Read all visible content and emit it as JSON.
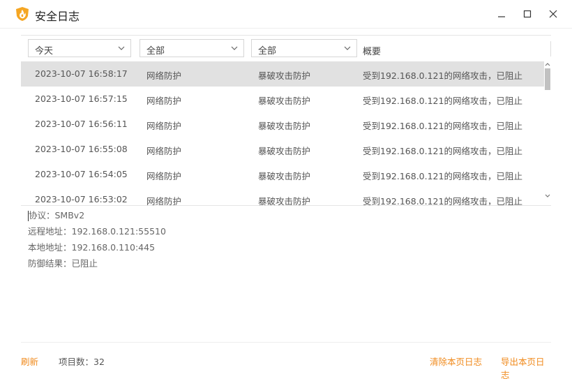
{
  "window": {
    "title": "安全日志",
    "icon": "shield-flame-logo-icon"
  },
  "filters": {
    "time": "今天",
    "category": "全部",
    "type": "全部",
    "summary_header": "概要"
  },
  "rows": [
    {
      "time": "2023-10-07 16:58:17",
      "category": "网络防护",
      "type": "暴破攻击防护",
      "summary": "受到192.168.0.121的网络攻击，已阻止"
    },
    {
      "time": "2023-10-07 16:57:15",
      "category": "网络防护",
      "type": "暴破攻击防护",
      "summary": "受到192.168.0.121的网络攻击，已阻止"
    },
    {
      "time": "2023-10-07 16:56:11",
      "category": "网络防护",
      "type": "暴破攻击防护",
      "summary": "受到192.168.0.121的网络攻击，已阻止"
    },
    {
      "time": "2023-10-07 16:55:08",
      "category": "网络防护",
      "type": "暴破攻击防护",
      "summary": "受到192.168.0.121的网络攻击，已阻止"
    },
    {
      "time": "2023-10-07 16:54:05",
      "category": "网络防护",
      "type": "暴破攻击防护",
      "summary": "受到192.168.0.121的网络攻击，已阻止"
    },
    {
      "time": "2023-10-07 16:53:02",
      "category": "网络防护",
      "type": "暴破攻击防护",
      "summary": "受到192.168.0.121的网络攻击，已阻止"
    }
  ],
  "details": {
    "protocol": "协议：SMBv2",
    "remote": "远程地址：192.168.0.121:55510",
    "local": "本地地址：192.168.0.110:445",
    "result": "防御结果：已阻止"
  },
  "footer": {
    "refresh": "刷新",
    "count": "项目数：32",
    "clear": "清除本页日志",
    "export": "导出本页日志"
  },
  "colors": {
    "accent": "#f08a1c",
    "selected_row": "#e1e1e1"
  }
}
